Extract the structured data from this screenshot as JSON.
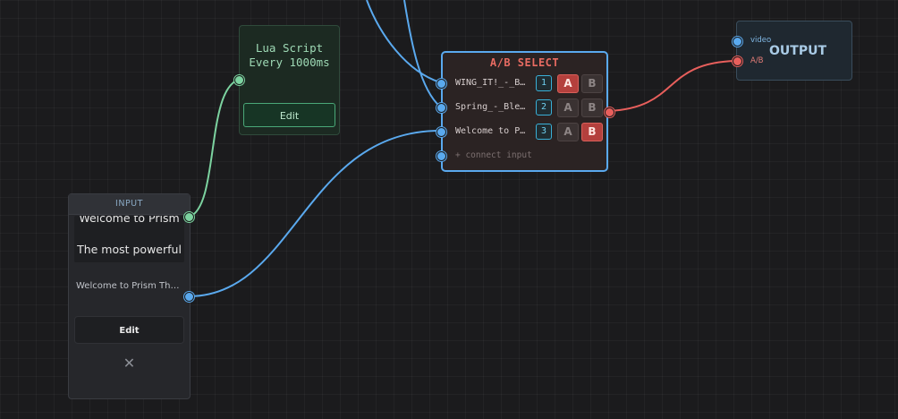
{
  "lua_node": {
    "title_line1": "Lua Script",
    "title_line2": "Every 1000ms",
    "edit_label": "Edit"
  },
  "ab_select": {
    "title": "A/B SELECT",
    "rows": [
      {
        "name": "WING_IT!_-_Bl…",
        "index": "1",
        "a": "A",
        "b": "B",
        "selected": "A"
      },
      {
        "name": "Spring_-_Blen…",
        "index": "2",
        "a": "A",
        "b": "B",
        "selected": ""
      },
      {
        "name": "Welcome to Pr…",
        "index": "3",
        "a": "A",
        "b": "B",
        "selected": "B"
      }
    ],
    "connect_label": "+ connect input"
  },
  "output_node": {
    "title": "OUTPUT",
    "ports": [
      "video",
      "A/B"
    ]
  },
  "input_node": {
    "header": "INPUT",
    "preview_line1": "Welcome to Prism",
    "preview_line2": "The most powerful",
    "text": "Welcome to Prism The most powerful",
    "edit_label": "Edit",
    "close_glyph": "✕"
  },
  "colors": {
    "background": "#1b1b1d",
    "blue_edge": "#5aa9ee",
    "red_edge": "#e85f5c",
    "green_edge": "#7cd3a0",
    "ab_accent": "#e86b62"
  },
  "icons": [
    "close-icon"
  ]
}
